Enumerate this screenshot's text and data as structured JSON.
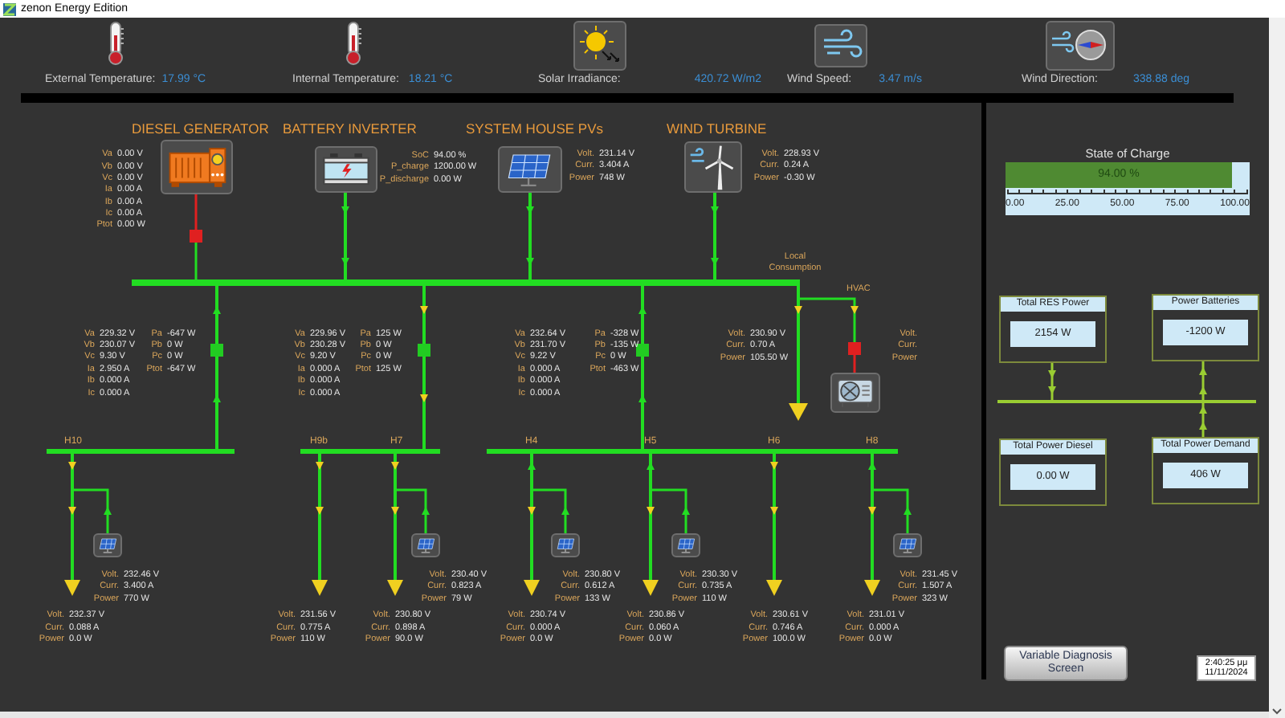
{
  "window": {
    "title": "zenon Energy Edition"
  },
  "sensors": [
    {
      "kind": "thermometer",
      "label": "External Temperature:",
      "value": "17.99 °C"
    },
    {
      "kind": "thermometer",
      "label": "Internal Temperature:",
      "value": "18.21 °C"
    },
    {
      "kind": "sun",
      "label": "Solar Irradiance:",
      "value": "420.72 W/m2"
    },
    {
      "kind": "wind",
      "label": "Wind Speed:",
      "value": "3.47 m/s"
    },
    {
      "kind": "compass",
      "label": "Wind Direction:",
      "value": "338.88 deg"
    }
  ],
  "sources": [
    {
      "kind": "diesel",
      "title": "DIESEL GENERATOR",
      "breaker_closed": false,
      "readings": [
        {
          "label": "Va",
          "value": "0.00 V"
        },
        {
          "label": "Vb",
          "value": "0.00 V"
        },
        {
          "label": "Vc",
          "value": "0.00 V"
        },
        {
          "label": "Ia",
          "value": "0.00 A"
        },
        {
          "label": "Ib",
          "value": "0.00 A"
        },
        {
          "label": "Ic",
          "value": "0.00 A"
        },
        {
          "label": "Ptot",
          "value": "0.00 W"
        }
      ]
    },
    {
      "kind": "battery",
      "title": "BATTERY INVERTER",
      "readings": [
        {
          "label": "SoC",
          "value": "94.00 %"
        },
        {
          "label": "P_charge",
          "value": "1200.00 W"
        },
        {
          "label": "P_discharge",
          "value": "0.00 W"
        }
      ]
    },
    {
      "kind": "pv",
      "title": "SYSTEM HOUSE PVs",
      "readings": [
        {
          "label": "Volt.",
          "value": "231.14 V"
        },
        {
          "label": "Curr.",
          "value": "3.404 A"
        },
        {
          "label": "Power",
          "value": "748 W"
        }
      ]
    },
    {
      "kind": "wind",
      "title": "WIND TURBINE",
      "readings": [
        {
          "label": "Volt.",
          "value": "228.93 V"
        },
        {
          "label": "Curr.",
          "value": "0.24 A"
        },
        {
          "label": "Power",
          "value": "-0.30 W"
        }
      ]
    }
  ],
  "feeders": [
    {
      "breaker_closed": true,
      "flow_up": true,
      "readings": [
        {
          "label": "Va",
          "value": "229.32 V"
        },
        {
          "label": "Vb",
          "value": "230.07 V"
        },
        {
          "label": "Vc",
          "value": "9.30 V"
        },
        {
          "label": "Ia",
          "value": "2.950 A"
        },
        {
          "label": "Ib",
          "value": "0.000 A"
        },
        {
          "label": "Ic",
          "value": "0.000 A"
        }
      ],
      "power_readings": [
        {
          "label": "Pa",
          "value": "-647 W"
        },
        {
          "label": "Pb",
          "value": "0 W"
        },
        {
          "label": "Pc",
          "value": "0 W"
        },
        {
          "label": "Ptot",
          "value": "-647 W"
        }
      ]
    },
    {
      "breaker_closed": true,
      "flow_up": false,
      "readings": [
        {
          "label": "Va",
          "value": "229.96 V"
        },
        {
          "label": "Vb",
          "value": "230.28 V"
        },
        {
          "label": "Vc",
          "value": "9.20 V"
        },
        {
          "label": "Ia",
          "value": "0.000 A"
        },
        {
          "label": "Ib",
          "value": "0.000 A"
        },
        {
          "label": "Ic",
          "value": "0.000 A"
        }
      ],
      "power_readings": [
        {
          "label": "Pa",
          "value": "125 W"
        },
        {
          "label": "Pb",
          "value": "0 W"
        },
        {
          "label": "Pc",
          "value": "0 W"
        },
        {
          "label": "Ptot",
          "value": "125 W"
        }
      ]
    },
    {
      "breaker_closed": true,
      "flow_up": true,
      "readings": [
        {
          "label": "Va",
          "value": "232.64 V"
        },
        {
          "label": "Vb",
          "value": "231.70 V"
        },
        {
          "label": "Vc",
          "value": "9.22 V"
        },
        {
          "label": "Ia",
          "value": "0.000 A"
        },
        {
          "label": "Ib",
          "value": "0.000 A"
        },
        {
          "label": "Ic",
          "value": "0.000 A"
        }
      ],
      "power_readings": [
        {
          "label": "Pa",
          "value": "-328 W"
        },
        {
          "label": "Pb",
          "value": "-135 W"
        },
        {
          "label": "Pc",
          "value": "0 W"
        },
        {
          "label": "Ptot",
          "value": "-463 W"
        }
      ]
    }
  ],
  "local_consumption": {
    "label": "Local Consumption",
    "readings": [
      {
        "label": "Volt.",
        "value": "230.90 V"
      },
      {
        "label": "Curr.",
        "value": "0.70 A"
      },
      {
        "label": "Power",
        "value": "105.50 W"
      }
    ]
  },
  "hvac": {
    "label": "HVAC",
    "breaker_closed": false,
    "readings": [
      {
        "label": "Volt."
      },
      {
        "label": "Curr."
      },
      {
        "label": "Power"
      }
    ]
  },
  "circuits": [
    {
      "label": "H10",
      "flow_up": false,
      "pv": {
        "readings": [
          {
            "label": "Volt.",
            "value": "232.46 V"
          },
          {
            "label": "Curr.",
            "value": "3.400 A"
          },
          {
            "label": "Power",
            "value": "770 W"
          }
        ]
      },
      "load": {
        "readings": [
          {
            "label": "Volt.",
            "value": "232.37 V"
          },
          {
            "label": "Curr.",
            "value": "0.088 A"
          },
          {
            "label": "Power",
            "value": "0.0 W"
          }
        ]
      }
    },
    {
      "label": "H9b",
      "flow_up": false,
      "load": {
        "readings": [
          {
            "label": "Volt.",
            "value": "231.56 V"
          },
          {
            "label": "Curr.",
            "value": "0.775 A"
          },
          {
            "label": "Power",
            "value": "110 W"
          }
        ]
      }
    },
    {
      "label": "H7",
      "flow_up": false,
      "pv": {
        "readings": [
          {
            "label": "Volt.",
            "value": "230.40 V"
          },
          {
            "label": "Curr.",
            "value": "0.823 A"
          },
          {
            "label": "Power",
            "value": "79 W"
          }
        ]
      },
      "load": {
        "readings": [
          {
            "label": "Volt.",
            "value": "230.80 V"
          },
          {
            "label": "Curr.",
            "value": "0.898 A"
          },
          {
            "label": "Power",
            "value": "90.0 W"
          }
        ]
      }
    },
    {
      "label": "H4",
      "flow_up": true,
      "pv": {
        "readings": [
          {
            "label": "Volt.",
            "value": "230.80 V"
          },
          {
            "label": "Curr.",
            "value": "0.612 A"
          },
          {
            "label": "Power",
            "value": "133 W"
          }
        ]
      },
      "load": {
        "readings": [
          {
            "label": "Volt.",
            "value": "230.74 V"
          },
          {
            "label": "Curr.",
            "value": "0.000 A"
          },
          {
            "label": "Power",
            "value": "0.0 W"
          }
        ]
      }
    },
    {
      "label": "H5",
      "flow_up": true,
      "pv": {
        "readings": [
          {
            "label": "Volt.",
            "value": "230.30 V"
          },
          {
            "label": "Curr.",
            "value": "0.735 A"
          },
          {
            "label": "Power",
            "value": "110 W"
          }
        ]
      },
      "load": {
        "readings": [
          {
            "label": "Volt.",
            "value": "230.86 V"
          },
          {
            "label": "Curr.",
            "value": "0.060 A"
          },
          {
            "label": "Power",
            "value": "0.0 W"
          }
        ]
      }
    },
    {
      "label": "H6",
      "flow_up": false,
      "load": {
        "readings": [
          {
            "label": "Volt.",
            "value": "230.61 V"
          },
          {
            "label": "Curr.",
            "value": "0.746 A"
          },
          {
            "label": "Power",
            "value": "100.0 W"
          }
        ]
      }
    },
    {
      "label": "H8",
      "flow_up": true,
      "pv": {
        "readings": [
          {
            "label": "Volt.",
            "value": "231.45 V"
          },
          {
            "label": "Curr.",
            "value": "1.507 A"
          },
          {
            "label": "Power",
            "value": "323 W"
          }
        ]
      },
      "load": {
        "readings": [
          {
            "label": "Volt.",
            "value": "231.01 V"
          },
          {
            "label": "Curr.",
            "value": "0.000 A"
          },
          {
            "label": "Power",
            "value": "0.0 W"
          }
        ]
      }
    }
  ],
  "state_of_charge": {
    "title": "State of Charge",
    "value": "94.00 %",
    "level": 0.94,
    "ticks": [
      "0.00",
      "25.00",
      "50.00",
      "75.00",
      "100.00"
    ]
  },
  "totals": [
    {
      "title": "Total RES Power",
      "value": "2154 W"
    },
    {
      "title": "Power Batteries",
      "value": "-1200 W"
    },
    {
      "title": "Total Power Diesel",
      "value": "0.00 W"
    },
    {
      "title": "Total Power Demand",
      "value": "406 W"
    }
  ],
  "diagnosis_button": "Variable Diagnosis Screen",
  "clock": {
    "time": "2:40:25 μμ",
    "date": "11/11/2024"
  }
}
